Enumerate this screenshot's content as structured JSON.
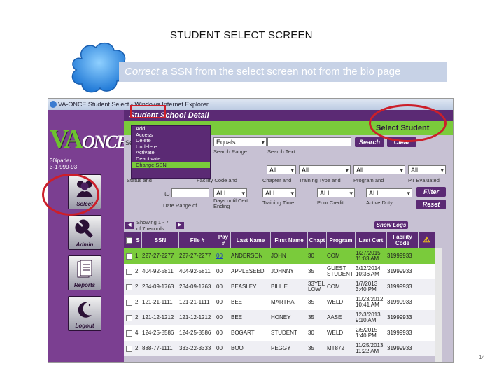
{
  "slide": {
    "title": "STUDENT SELECT SCREEN",
    "banner_italic": "Correct",
    "banner_rest": " a SSN from the select screen not from the bio page",
    "page_number": "14"
  },
  "browser": {
    "title": "VA-ONCE Student Select - Windows Internet Explorer"
  },
  "left_nav": {
    "logo_main": "VA",
    "logo_sub": "ONCE",
    "user_line1": "30ipader",
    "user_line2": "3-1-999-93",
    "buttons": [
      {
        "label": "Select",
        "icon": "people-icon"
      },
      {
        "label": "Admin",
        "icon": "wrench-icon"
      },
      {
        "label": "Reports",
        "icon": "reports-icon"
      },
      {
        "label": "Logout",
        "icon": "moon-icon"
      }
    ]
  },
  "header": {
    "title": "Student School Detail",
    "select_student": "Select Student"
  },
  "menu": {
    "items": [
      "Add",
      "Access",
      "Delete",
      "Undelete",
      "Activate",
      "Deactivate",
      "Change SSN"
    ],
    "highlighted": "Change SSN"
  },
  "search": {
    "select_label": "Se",
    "operator_value": "Equals",
    "search_range_label": "Search Range",
    "search_text_label": "Search Text",
    "search_button": "Search",
    "clear_button": "Clear"
  },
  "filters": {
    "status_label": "Status and",
    "facility_label": "Facility Code and",
    "chapter_label": "Chapter and",
    "training_type_label": "Training Type and",
    "program_label": "Program and",
    "pt_label": "PT Evaluated",
    "dropdown_all": "All",
    "to_label": "to",
    "all_upper": "ALL",
    "date_range_label": "Date Range of",
    "days_until_label": "Days until Cert Ending",
    "training_time_label": "Training Time",
    "prior_credit_label": "Prior Credit",
    "active_duty_label": "Active Duty",
    "filter_button": "Filter",
    "reset_button": "Reset"
  },
  "paging": {
    "showing": "Showing 1 - 7",
    "of_records": "of 7 records",
    "show_logs": "Show Logs"
  },
  "table": {
    "headers": [
      "S",
      "SSN",
      "File #",
      "Pay #",
      "Last Name",
      "First Name",
      "Chapt",
      "Program",
      "Last Cert",
      "Facility Code"
    ],
    "rows": [
      {
        "n": "1",
        "ssn": "227-27-2277",
        "file": "227-27-2277",
        "pay": "00",
        "last": "ANDERSON",
        "first": "JOHN",
        "chapt": "30",
        "program": "COM",
        "cert": "1/27/2015 11:03 AM",
        "fac": "31999933"
      },
      {
        "n": "2",
        "ssn": "404-92-5811",
        "file": "404-92-5811",
        "pay": "00",
        "last": "APPLESEED",
        "first": "JOHNNY",
        "chapt": "35",
        "program": "GUEST STUDENT",
        "cert": "3/12/2014 10:36 AM",
        "fac": "31999933"
      },
      {
        "n": "2",
        "ssn": "234-09-1763",
        "file": "234-09-1763",
        "pay": "00",
        "last": "BEASLEY",
        "first": "BILLIE",
        "chapt": "33YEL LOW",
        "program": "COM",
        "cert": "1/7/2013 3:40 PM",
        "fac": "31999933"
      },
      {
        "n": "2",
        "ssn": "121-21-1111",
        "file": "121-21-1111",
        "pay": "00",
        "last": "BEE",
        "first": "MARTHA",
        "chapt": "35",
        "program": "WELD",
        "cert": "11/23/2012 10:41 AM",
        "fac": "31999933"
      },
      {
        "n": "2",
        "ssn": "121-12-1212",
        "file": "121-12-1212",
        "pay": "00",
        "last": "BEE",
        "first": "HONEY",
        "chapt": "35",
        "program": "AASE",
        "cert": "12/3/2013 9:10 AM",
        "fac": "31999933"
      },
      {
        "n": "4",
        "ssn": "124-25-8586",
        "file": "124-25-8586",
        "pay": "00",
        "last": "BOGART",
        "first": "STUDENT",
        "chapt": "30",
        "program": "WELD",
        "cert": "2/5/2015 1:40 PM",
        "fac": "31999933"
      },
      {
        "n": "2",
        "ssn": "888-77-1111",
        "file": "333-22-3333",
        "pay": "00",
        "last": "BOO",
        "first": "PEGGY",
        "chapt": "35",
        "program": "MT872",
        "cert": "11/25/2013 11:22 AM",
        "fac": "31999933"
      }
    ]
  },
  "colors": {
    "purple": "#5b2a74",
    "green": "#7acb3b",
    "highlight_red": "#cc1f2a",
    "cloud": "#2f8fe8"
  }
}
